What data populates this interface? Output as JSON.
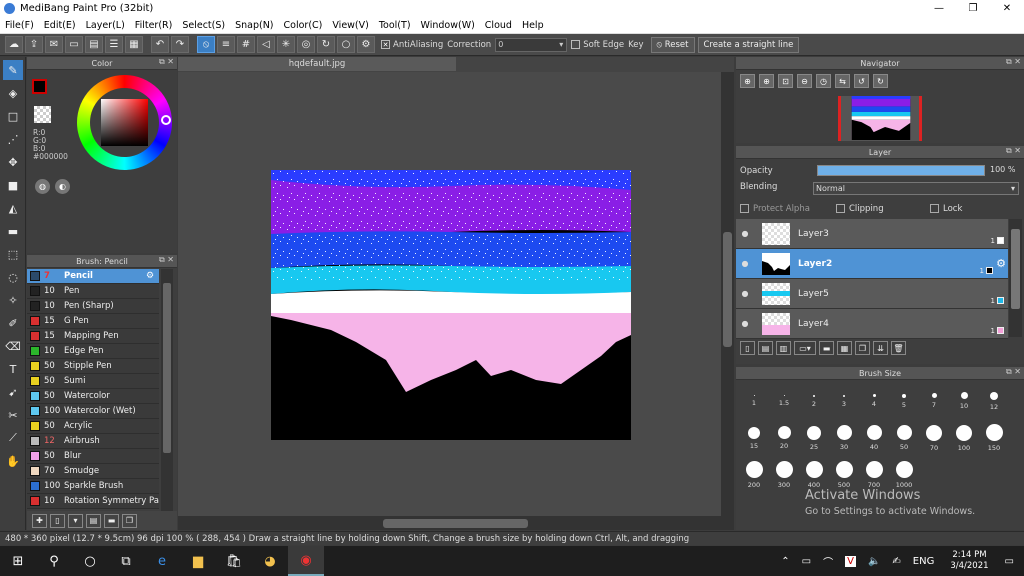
{
  "window": {
    "title": "MediBang Paint Pro (32bit)",
    "minimize": "—",
    "maximize": "❐",
    "close": "✕"
  },
  "menu": [
    "File(F)",
    "Edit(E)",
    "Layer(L)",
    "Filter(R)",
    "Select(S)",
    "Snap(N)",
    "Color(C)",
    "View(V)",
    "Tool(T)",
    "Window(W)",
    "Cloud",
    "Help"
  ],
  "toolbar": {
    "antialiasing_label": "AntiAliasing",
    "correction_label": "Correction",
    "correction_value": "0",
    "soft_edge_label": "Soft Edge",
    "key_label": "Key",
    "reset_label": "Reset",
    "straight_line_label": "Create a straight line"
  },
  "color_panel": {
    "title": "Color",
    "r": "R:0",
    "g": "G:0",
    "b": "B:0",
    "hex": "#000000",
    "fg_color": "#000000"
  },
  "brush_panel": {
    "title": "Brush: Pencil",
    "brushes": [
      {
        "size": "7",
        "name": "Pencil",
        "color": "#2b4a6b",
        "selected": true
      },
      {
        "size": "10",
        "name": "Pen",
        "color": "#222222"
      },
      {
        "size": "10",
        "name": "Pen (Sharp)",
        "color": "#222222"
      },
      {
        "size": "15",
        "name": "G Pen",
        "color": "#d93030"
      },
      {
        "size": "15",
        "name": "Mapping Pen",
        "color": "#d93030"
      },
      {
        "size": "10",
        "name": "Edge Pen",
        "color": "#2bb52b"
      },
      {
        "size": "50",
        "name": "Stipple Pen",
        "color": "#e8d020"
      },
      {
        "size": "50",
        "name": "Sumi",
        "color": "#e8d020"
      },
      {
        "size": "50",
        "name": "Watercolor",
        "color": "#5ec8f0"
      },
      {
        "size": "100",
        "name": "Watercolor (Wet)",
        "color": "#5ec8f0"
      },
      {
        "size": "50",
        "name": "Acrylic",
        "color": "#e8d020"
      },
      {
        "size": "12",
        "name": "Airbrush",
        "color": "#bbbbbb"
      },
      {
        "size": "50",
        "name": "Blur",
        "color": "#f0a0e8"
      },
      {
        "size": "70",
        "name": "Smudge",
        "color": "#f0d8c0"
      },
      {
        "size": "100",
        "name": "Sparkle Brush",
        "color": "#2c6fd0"
      },
      {
        "size": "10",
        "name": "Rotation Symmetry Pa",
        "color": "#d93030"
      }
    ]
  },
  "document": {
    "tab": "hqdefault.jpg"
  },
  "navigator": {
    "title": "Navigator"
  },
  "layer_panel": {
    "title": "Layer",
    "opacity_label": "Opacity",
    "opacity_value": "100 %",
    "opacity": 1.0,
    "blending_label": "Blending",
    "blending_value": "Normal",
    "protect_alpha": "Protect Alpha",
    "clipping": "Clipping",
    "lock": "Lock",
    "layers": [
      {
        "name": "Layer3",
        "badge": "1",
        "color": "#ffffff",
        "selected": false
      },
      {
        "name": "Layer2",
        "badge": "1",
        "color": "#000000",
        "selected": true
      },
      {
        "name": "Layer5",
        "badge": "1",
        "color": "#1fb8e8",
        "selected": false
      },
      {
        "name": "Layer4",
        "badge": "1",
        "color": "#f4a0d8",
        "selected": false
      }
    ]
  },
  "brush_size_panel": {
    "title": "Brush Size",
    "sizes": [
      "1",
      "1.5",
      "2",
      "3",
      "4",
      "5",
      "7",
      "10",
      "12",
      "15",
      "20",
      "25",
      "30",
      "40",
      "50",
      "70",
      "100",
      "150",
      "200",
      "300",
      "400",
      "500",
      "700",
      "1000"
    ]
  },
  "watermark": {
    "line1": "Activate Windows",
    "line2": "Go to Settings to activate Windows."
  },
  "status": {
    "text": "480 * 360 pixel  (12.7 * 9.5cm)  96 dpi  100 %  ( 288, 454 )  Draw a straight line by holding down Shift, Change a brush size by holding down Ctrl, Alt, and dragging"
  },
  "taskbar": {
    "lang": "ENG",
    "time": "2:14 PM",
    "date": "3/4/2021"
  },
  "palette": {
    "sky_top": "#2a3cff",
    "purple": "#8a1ee6",
    "blue": "#1d4af0",
    "cyan": "#18c8f0",
    "white": "#ffffff",
    "pink": "#f6b4e8",
    "mountains": "#000000"
  }
}
